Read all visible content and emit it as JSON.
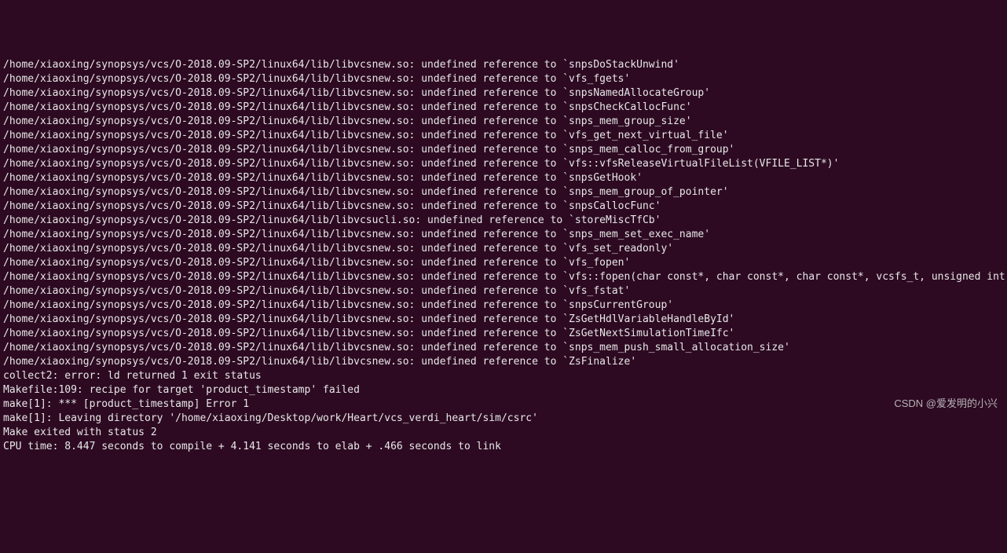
{
  "terminal": {
    "lines": [
      "/home/xiaoxing/synopsys/vcs/O-2018.09-SP2/linux64/lib/libvcsnew.so: undefined reference to `snpsDoStackUnwind'",
      "/home/xiaoxing/synopsys/vcs/O-2018.09-SP2/linux64/lib/libvcsnew.so: undefined reference to `vfs_fgets'",
      "/home/xiaoxing/synopsys/vcs/O-2018.09-SP2/linux64/lib/libvcsnew.so: undefined reference to `snpsNamedAllocateGroup'",
      "/home/xiaoxing/synopsys/vcs/O-2018.09-SP2/linux64/lib/libvcsnew.so: undefined reference to `snpsCheckCallocFunc'",
      "/home/xiaoxing/synopsys/vcs/O-2018.09-SP2/linux64/lib/libvcsnew.so: undefined reference to `snps_mem_group_size'",
      "/home/xiaoxing/synopsys/vcs/O-2018.09-SP2/linux64/lib/libvcsnew.so: undefined reference to `vfs_get_next_virtual_file'",
      "/home/xiaoxing/synopsys/vcs/O-2018.09-SP2/linux64/lib/libvcsnew.so: undefined reference to `snps_mem_calloc_from_group'",
      "/home/xiaoxing/synopsys/vcs/O-2018.09-SP2/linux64/lib/libvcsnew.so: undefined reference to `vfs::vfsReleaseVirtualFileList(VFILE_LIST*)'",
      "/home/xiaoxing/synopsys/vcs/O-2018.09-SP2/linux64/lib/libvcsnew.so: undefined reference to `snpsGetHook'",
      "/home/xiaoxing/synopsys/vcs/O-2018.09-SP2/linux64/lib/libvcsnew.so: undefined reference to `snps_mem_group_of_pointer'",
      "/home/xiaoxing/synopsys/vcs/O-2018.09-SP2/linux64/lib/libvcsnew.so: undefined reference to `snpsCallocFunc'",
      "/home/xiaoxing/synopsys/vcs/O-2018.09-SP2/linux64/lib/libvcsucli.so: undefined reference to `storeMiscTfCb'",
      "/home/xiaoxing/synopsys/vcs/O-2018.09-SP2/linux64/lib/libvcsnew.so: undefined reference to `snps_mem_set_exec_name'",
      "/home/xiaoxing/synopsys/vcs/O-2018.09-SP2/linux64/lib/libvcsnew.so: undefined reference to `vfs_set_readonly'",
      "/home/xiaoxing/synopsys/vcs/O-2018.09-SP2/linux64/lib/libvcsnew.so: undefined reference to `vfs_fopen'",
      "/home/xiaoxing/synopsys/vcs/O-2018.09-SP2/linux64/lib/libvcsnew.so: undefined reference to `vfs::fopen(char const*, char const*, char const*, vcsfs_t, unsigned int)'",
      "/home/xiaoxing/synopsys/vcs/O-2018.09-SP2/linux64/lib/libvcsnew.so: undefined reference to `vfs_fstat'",
      "/home/xiaoxing/synopsys/vcs/O-2018.09-SP2/linux64/lib/libvcsnew.so: undefined reference to `snpsCurrentGroup'",
      "/home/xiaoxing/synopsys/vcs/O-2018.09-SP2/linux64/lib/libvcsnew.so: undefined reference to `ZsGetHdlVariableHandleById'",
      "/home/xiaoxing/synopsys/vcs/O-2018.09-SP2/linux64/lib/libvcsnew.so: undefined reference to `ZsGetNextSimulationTimeIfc'",
      "/home/xiaoxing/synopsys/vcs/O-2018.09-SP2/linux64/lib/libvcsnew.so: undefined reference to `snps_mem_push_small_allocation_size'",
      "/home/xiaoxing/synopsys/vcs/O-2018.09-SP2/linux64/lib/libvcsnew.so: undefined reference to `ZsFinalize'",
      "collect2: error: ld returned 1 exit status",
      "Makefile:109: recipe for target 'product_timestamp' failed",
      "make[1]: *** [product_timestamp] Error 1",
      "make[1]: Leaving directory '/home/xiaoxing/Desktop/work/Heart/vcs_verdi_heart/sim/csrc'",
      "Make exited with status 2",
      "CPU time: 8.447 seconds to compile + 4.141 seconds to elab + .466 seconds to link"
    ]
  },
  "watermark": "CSDN @爱发明的小兴"
}
